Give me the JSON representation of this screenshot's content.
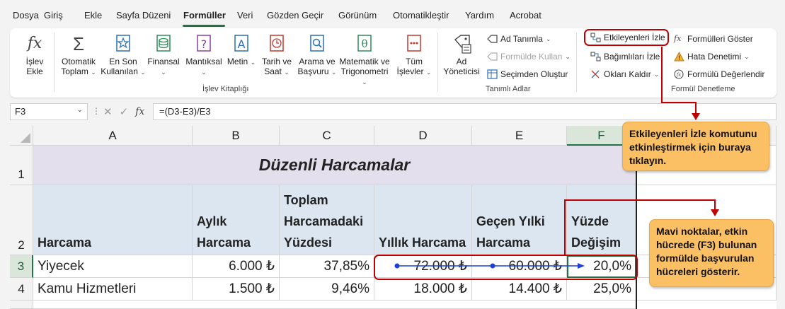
{
  "menu": {
    "tabs": [
      "Dosya",
      "Giriş",
      "Ekle",
      "Sayfa Düzeni",
      "Formüller",
      "Veri",
      "Gözden Geçir",
      "Görünüm",
      "Otomatikleştir",
      "Yardım",
      "Acrobat"
    ],
    "active": "Formüller"
  },
  "ribbon": {
    "insert_function": {
      "line1": "İşlev",
      "line2": "Ekle"
    },
    "autosum": {
      "line1": "Otomatik",
      "line2": "Toplam"
    },
    "recent": {
      "line1": "En Son",
      "line2": "Kullanılan"
    },
    "financial": {
      "line1": "Finansal"
    },
    "logical": {
      "line1": "Mantıksal"
    },
    "text": {
      "line1": "Metin"
    },
    "datetime": {
      "line1": "Tarih ve",
      "line2": "Saat"
    },
    "lookup": {
      "line1": "Arama ve",
      "line2": "Başvuru"
    },
    "math": {
      "line1": "Matematik ve",
      "line2": "Trigonometri"
    },
    "more": {
      "line1": "Tüm",
      "line2": "İşlevler"
    },
    "group_library": "İşlev Kitaplığı",
    "name_manager": {
      "line1": "Ad",
      "line2": "Yöneticisi"
    },
    "define_name": "Ad Tanımla",
    "use_in_formula": "Formülde Kullan",
    "create_from_selection": "Seçimden Oluştur",
    "group_names": "Tanımlı Adlar",
    "trace_precedents": "Etkileyenleri İzle",
    "trace_dependents": "Bağımlıları İzle",
    "remove_arrows": "Okları Kaldır",
    "show_formulas": "Formülleri Göster",
    "error_checking": "Hata Denetimi",
    "evaluate_formula": "Formülü Değerlendir",
    "group_auditing": "Formül Denetleme"
  },
  "formula_bar": {
    "name_box": "F3",
    "formula": "=(D3-E3)/E3",
    "fx": "fx"
  },
  "sheet": {
    "columns": [
      "A",
      "B",
      "C",
      "D",
      "E",
      "F"
    ],
    "rows": [
      "1",
      "2",
      "3",
      "4"
    ],
    "title": "Düzenli Harcamalar",
    "headers": {
      "a": "Harcama",
      "b": [
        "Aylık",
        "Harcama"
      ],
      "c": [
        "Toplam",
        "Harcamadaki",
        "Yüzdesi"
      ],
      "d": "Yıllık Harcama",
      "e": [
        "Geçen Yılki",
        "Harcama"
      ],
      "f": [
        "Yüzde",
        "Değişim"
      ]
    },
    "row3": {
      "a": "Yiyecek",
      "b": "6.000 ₺",
      "c": "37,85%",
      "d": "72.000 ₺",
      "e": "60.000 ₺",
      "f": "20,0%"
    },
    "row4": {
      "a": "Kamu Hizmetleri",
      "b": "1.500 ₺",
      "c": "9,46%",
      "d": "18.000 ₺",
      "e": "14.400 ₺",
      "f": "25,0%"
    }
  },
  "callouts": {
    "top": "Etkileyenleri İzle komutunu etkinleştirmek için buraya tıklayın.",
    "bottom": "Mavi noktalar, etkin hücrede (F3) bulunan formülde başvurulan hücreleri gösterir."
  },
  "colors": {
    "accent": "#217346",
    "callout": "#fbbf64",
    "highlight": "#c00000",
    "tracer": "#1f3fd6",
    "title_fill": "#e4dfec",
    "header_fill": "#dce6f1"
  }
}
